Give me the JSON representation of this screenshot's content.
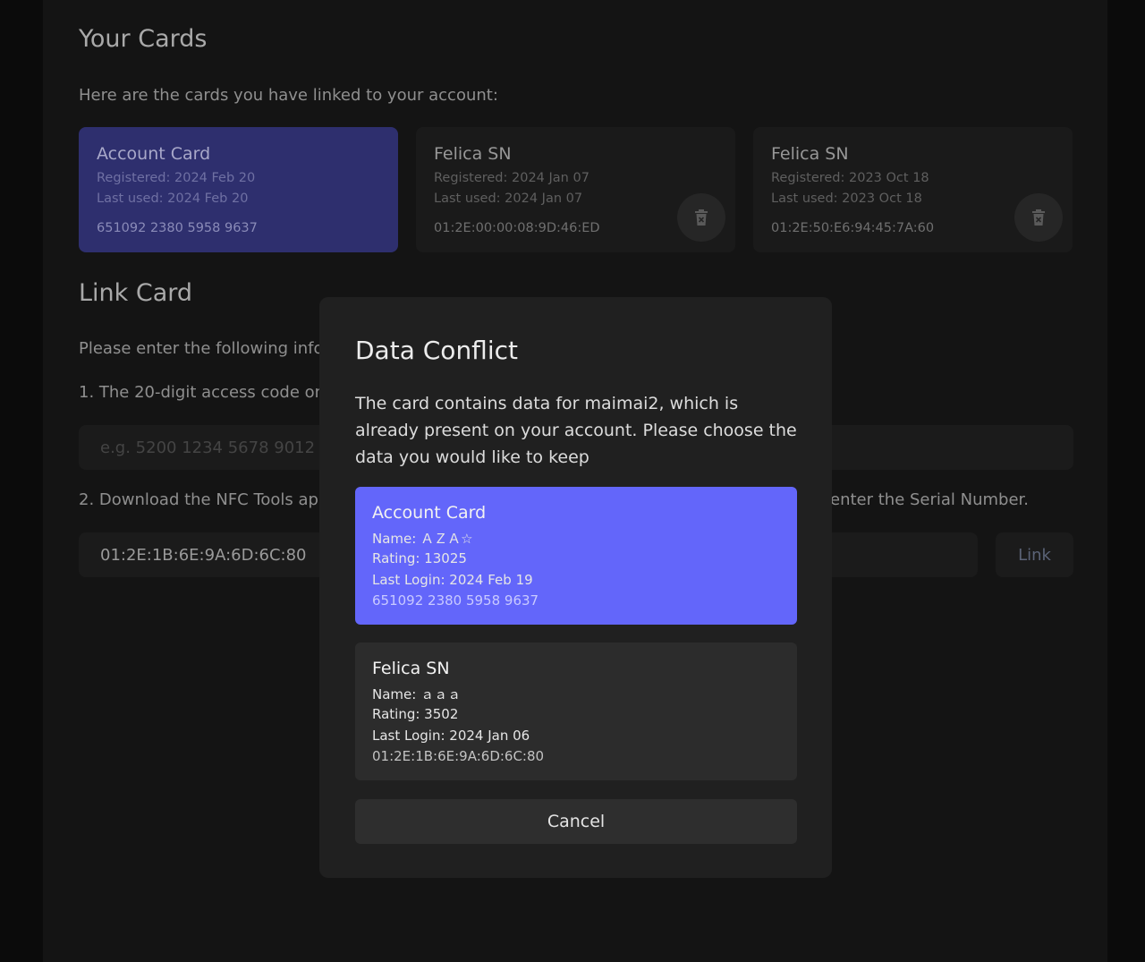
{
  "cards_section": {
    "title": "Your Cards",
    "subtitle": "Here are the cards you have linked to your account:",
    "cards": [
      {
        "name": "Account Card",
        "registered": "Registered: 2024 Feb 20",
        "last_used": "Last used: 2024 Feb 20",
        "id": "651092 2380 5958 9637"
      },
      {
        "name": "Felica SN",
        "registered": "Registered: 2024 Jan 07",
        "last_used": "Last used: 2024 Jan 07",
        "id": "01:2E:00:00:08:9D:46:ED"
      },
      {
        "name": "Felica SN",
        "registered": "Registered: 2023 Oct 18",
        "last_used": "Last used: 2023 Oct 18",
        "id": "01:2E:50:E6:94:45:7A:60"
      }
    ]
  },
  "link_section": {
    "title": "Link Card",
    "intro": "Please enter the following info",
    "step1": "1. The 20-digit access code on",
    "access_code_placeholder": "e.g. 5200 1234 5678 9012 34",
    "step2_start": "2. Download the NFC Tools ap",
    "step2_end": "enter the Serial Number.",
    "serial_value": "01:2E:1B:6E:9A:6D:6C:80",
    "link_label": "Link"
  },
  "modal": {
    "title": "Data Conflict",
    "description": "The card contains data for maimai2, which is already present on your account. Please choose the data you would like to keep",
    "options": [
      {
        "name": "Account Card",
        "player_name": "Name: ＡＺＡ☆",
        "rating": "Rating: 13025",
        "last_login": "Last Login: 2024 Feb 19",
        "id": "651092 2380 5958 9637"
      },
      {
        "name": "Felica SN",
        "player_name": "Name: ａａａ",
        "rating": "Rating: 3502",
        "last_login": "Last Login: 2024 Jan 06",
        "id": "01:2E:1B:6E:9A:6D:6C:80"
      }
    ],
    "cancel_label": "Cancel"
  },
  "icons": {
    "trash": "trash-icon"
  }
}
